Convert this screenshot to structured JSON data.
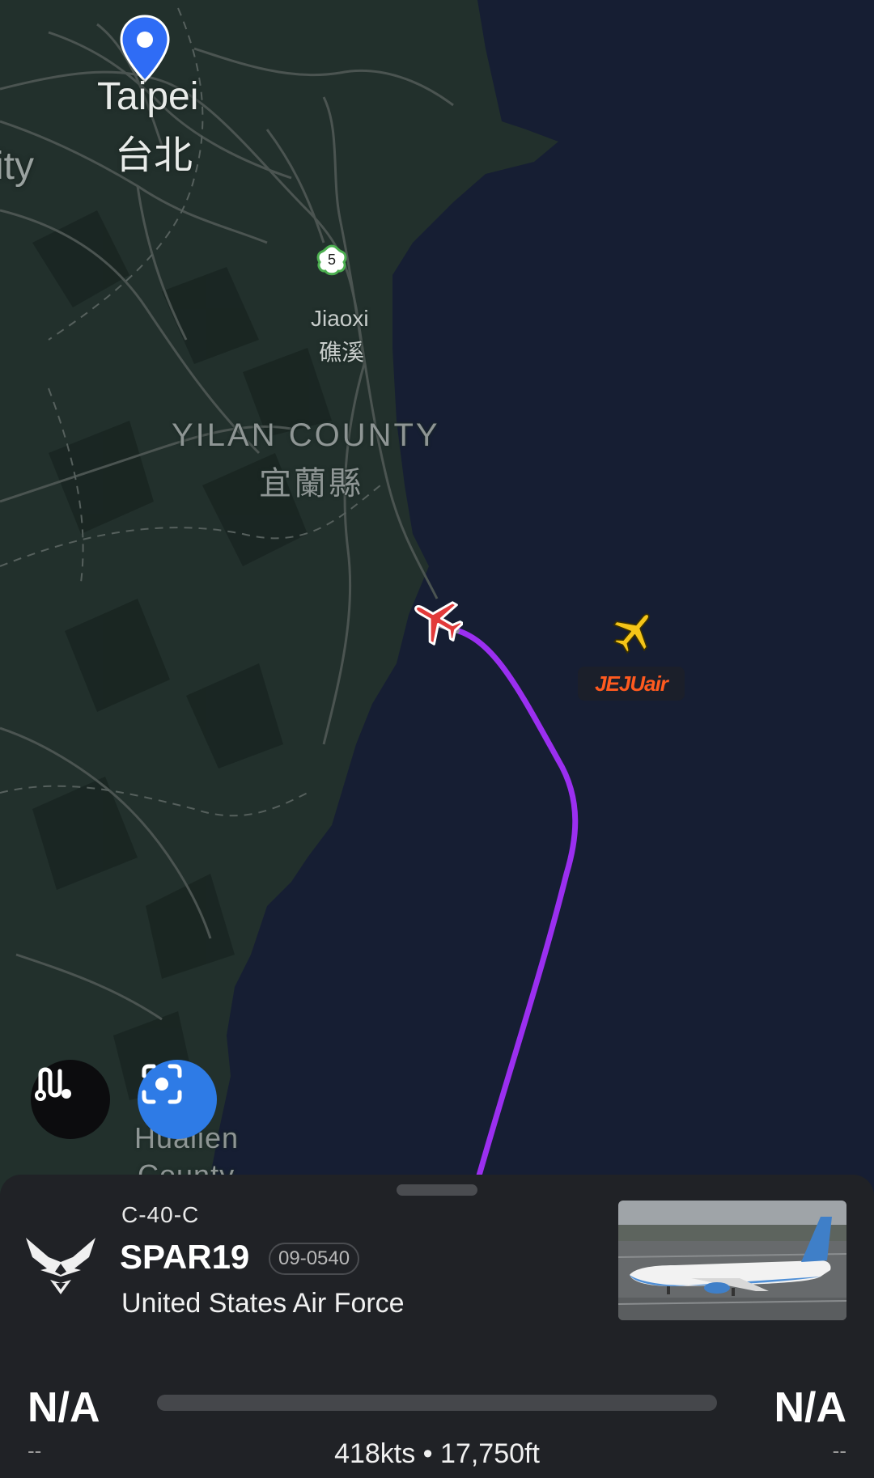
{
  "map": {
    "labels": {
      "taipei_en": "Taipei",
      "taipei_zh": "台北",
      "city_fragment": "ity",
      "highway_shield": "5",
      "jiaoxi_en": "Jiaoxi",
      "jiaoxi_zh": "礁溪",
      "yilan_en": "YILAN COUNTY",
      "yilan_zh": "宜蘭縣",
      "hualien_en": "Hualien",
      "hualien_partial": "County"
    },
    "other_aircraft_airline": "JEJUair",
    "colors": {
      "land": "#22302c",
      "sea": "#161e33",
      "track": "#9b2ff0",
      "selected_aircraft": "#e23a3a",
      "other_aircraft": "#f5c518",
      "pin": "#2f6cf5",
      "locate_button": "#2e7be6"
    },
    "icons": [
      "location-pin-icon",
      "route-icon",
      "locate-focus-icon",
      "airplane-icon"
    ]
  },
  "flight": {
    "aircraft_type": "C-40-C",
    "callsign": "SPAR19",
    "registration": "09-0540",
    "operator": "United States Air Force",
    "operator_logo": "usaf-wings-logo",
    "origin_code": "N/A",
    "origin_time": "--",
    "destination_code": "N/A",
    "destination_time": "--",
    "progress": 0,
    "speed_altitude": "418kts • 17,750ft"
  }
}
